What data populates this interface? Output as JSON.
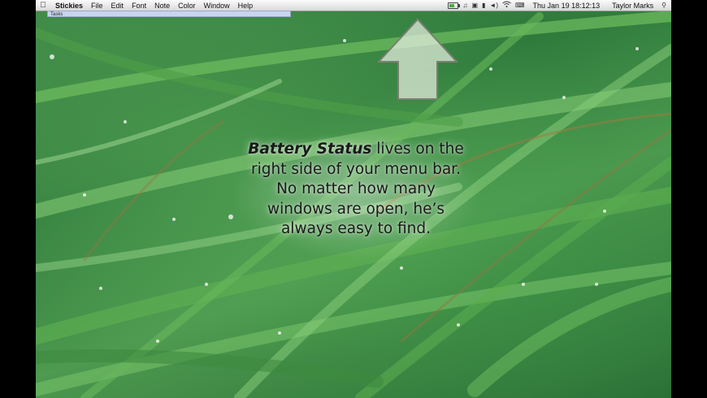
{
  "menubar": {
    "apple_icon": "apple-logo-icon",
    "app_name": "Stickies",
    "menus": [
      "File",
      "Edit",
      "Font",
      "Note",
      "Color",
      "Window",
      "Help"
    ],
    "status_icons": [
      "battery-icon",
      "music-note-icon",
      "display-icon",
      "monitor-icon",
      "volume-icon",
      "wifi-icon",
      "keyboard-icon"
    ],
    "clock": "Thu Jan 19  18:12:13",
    "user": "Taylor Marks",
    "search_icon": "spotlight-search-icon"
  },
  "sticky_note": {
    "title": "Tasks"
  },
  "caption": {
    "bold": "Battery Status",
    "line1_rest": " lives on the",
    "line2": "right side of your menu bar.",
    "line3": "No matter how many",
    "line4": "windows are open, he’s",
    "line5": "always easy to find."
  },
  "battery": {
    "level": 0.6,
    "color": "#4caa3c"
  },
  "colors": {
    "grass_dark": "#276a33",
    "grass_light": "#7ec66f",
    "arrow": "#e8eee0"
  }
}
